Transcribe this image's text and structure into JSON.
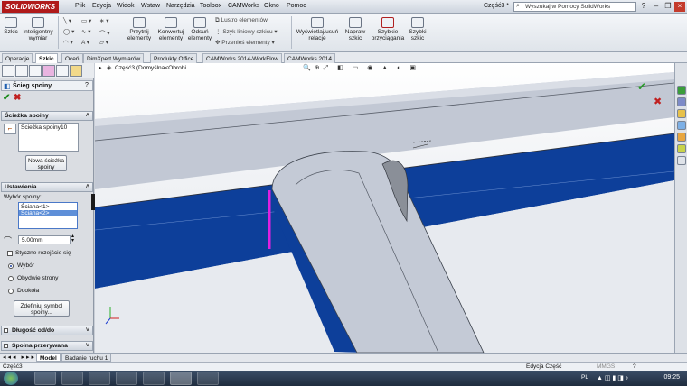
{
  "app": {
    "logo_text": "SOLIDWORKS",
    "document_title": "Część3 *",
    "search_placeholder": "Wyszukaj w Pomocy SolidWorks"
  },
  "menu": [
    "Plik",
    "Edycja",
    "Widok",
    "Wstaw",
    "Narzędzia",
    "Toolbox",
    "CAMWorks",
    "Okno",
    "Pomoc"
  ],
  "ribbon": {
    "szkic": "Szkic",
    "inteligentny_wymiar": "Inteligentny wymiar",
    "przytnij_elementy": "Przytnij elementy",
    "konwertuj_elementy": "Konwertuj elementy",
    "odsun_elementy": "Odsuń elementy",
    "lustro_elementow": "Lustro elementów",
    "szyk_liniowy_szkicu": "Szyk liniowy szkicu",
    "przenies_elementy": "Przenieś elementy",
    "wyswietlaj_usun_relacje": "Wyświetlaj/usuń relacje",
    "napraw_szkic": "Napraw szkic",
    "szybkie_przyciaganie": "Szybkie przyciągania",
    "szybki_szkic": "Szybki szkic"
  },
  "tabs": [
    "Operacje",
    "Szkic",
    "Oceń",
    "DimXpert Wymiarów",
    "Produkty Office",
    "CAMWorks 2014-WorkFlow",
    "CAMWorks 2014"
  ],
  "active_tab": "Szkic",
  "property_manager": {
    "title": "Ścieg spoiny",
    "sciezka_group": {
      "title": "Ścieżka spoiny",
      "items": [
        "Ścieżka spoiny10"
      ],
      "new_button": "Nowa ścieżka spoiny"
    },
    "ustawienia_group": {
      "title": "Ustawienia",
      "wybor_label": "Wybór spoiny:",
      "selection": [
        "Ściana<1>",
        "Ściana<2>"
      ],
      "size_value": "5.00mm",
      "tangent_label": "Styczne rozejście się",
      "radio_wybor": "Wybór",
      "radio_obydwie": "Obydwie strony",
      "radio_dookola": "Dookoła",
      "define_symbol_button": "Zdefiniuj symbol spoiny..."
    },
    "dlugosc_group": {
      "title": "Długość od/do"
    },
    "przerywana_group": {
      "title": "Spoina przerywana"
    }
  },
  "viewport": {
    "breadcrumb": "Część3 (Domyślna<Obrobi...",
    "colors": {
      "beam_blue": "#0d3f9a",
      "beam_grey": "#c4cad6",
      "weld_highlight": "#e020e0"
    }
  },
  "bottom_tabs": [
    "Model",
    "Badanie ruchu 1"
  ],
  "active_bottom_tab": "Model",
  "status": {
    "left": "Część3",
    "mode": "Edycja Część",
    "units": "MMGS"
  },
  "taskbar": {
    "language": "PL",
    "time": "09:25"
  }
}
